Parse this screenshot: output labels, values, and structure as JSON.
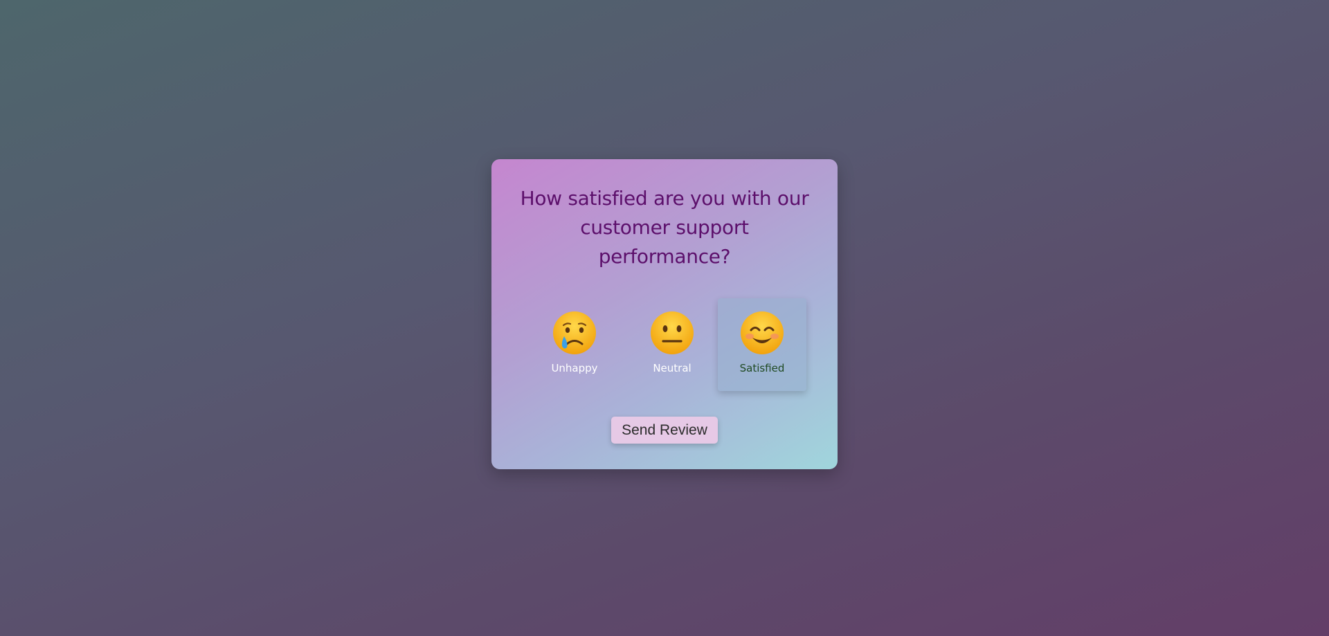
{
  "survey": {
    "question": "How satisfied are you with our customer support performance?",
    "selected": "Satisfied",
    "options": [
      {
        "label": "Unhappy",
        "icon": "crying-face-icon"
      },
      {
        "label": "Neutral",
        "icon": "neutral-face-icon"
      },
      {
        "label": "Satisfied",
        "icon": "smiling-face-icon"
      }
    ],
    "submit_label": "Send Review"
  },
  "colors": {
    "question_text": "#5c0f6b",
    "selected_label": "#1f4a22",
    "button_bg": "#e6c9e6"
  }
}
